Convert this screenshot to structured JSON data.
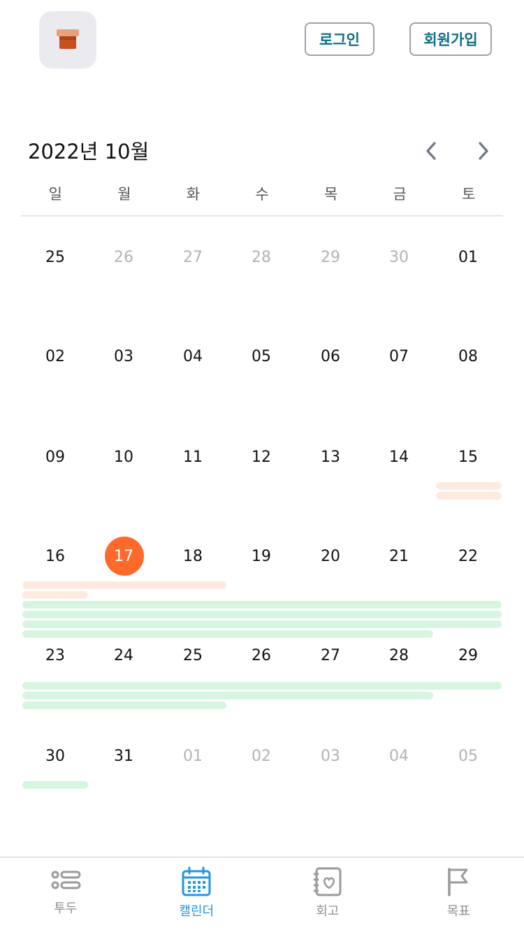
{
  "header": {
    "logo_icon": "box-icon",
    "login_label": "로그인",
    "signup_label": "회원가입"
  },
  "calendar": {
    "month_title": "2022년 10월",
    "weekdays": [
      "일",
      "월",
      "화",
      "수",
      "목",
      "금",
      "토"
    ],
    "weeks": [
      [
        "25",
        "26",
        "27",
        "28",
        "29",
        "30",
        "01"
      ],
      [
        "02",
        "03",
        "04",
        "05",
        "06",
        "07",
        "08"
      ],
      [
        "09",
        "10",
        "11",
        "12",
        "13",
        "14",
        "15"
      ],
      [
        "16",
        "17",
        "18",
        "19",
        "20",
        "21",
        "22"
      ],
      [
        "23",
        "24",
        "25",
        "26",
        "27",
        "28",
        "29"
      ],
      [
        "30",
        "31",
        "01",
        "02",
        "03",
        "04",
        "05"
      ]
    ],
    "today": "17",
    "accent_color": "#ff6a2b"
  },
  "tabs": [
    {
      "label": "투두",
      "icon": "list-icon",
      "active": false
    },
    {
      "label": "캘린더",
      "icon": "calendar-icon",
      "active": true
    },
    {
      "label": "회고",
      "icon": "journal-heart-icon",
      "active": false
    },
    {
      "label": "목표",
      "icon": "flag-icon",
      "active": false
    }
  ],
  "colors": {
    "active_tab": "#2196e3",
    "event_peach": "#fdebe2",
    "event_mint": "#d8f5e2",
    "button_text": "#0f6f86"
  }
}
